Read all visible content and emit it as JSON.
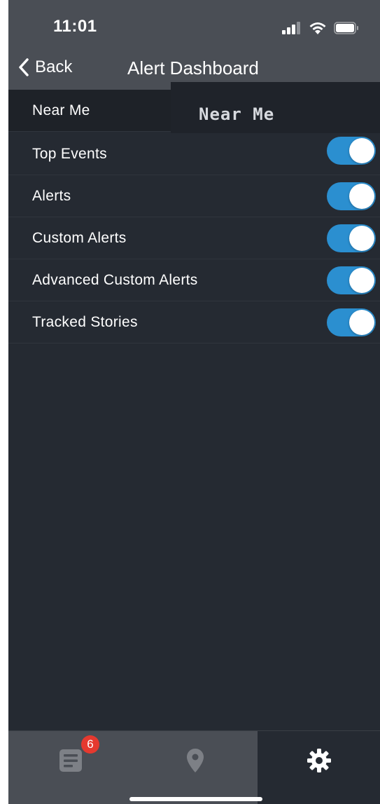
{
  "status_bar": {
    "time": "11:01",
    "icons": [
      "signal-icon",
      "wifi-icon",
      "battery-icon"
    ]
  },
  "nav": {
    "back_label": "Back",
    "title": "Alert Dashboard"
  },
  "near_me": {
    "label": "Near Me",
    "badge_text": "Near Me"
  },
  "settings": [
    {
      "label": "Top Events",
      "enabled": true
    },
    {
      "label": "Alerts",
      "enabled": true
    },
    {
      "label": "Custom Alerts",
      "enabled": true
    },
    {
      "label": "Advanced Custom Alerts",
      "enabled": true
    },
    {
      "label": "Tracked Stories",
      "enabled": true
    }
  ],
  "tabbar": {
    "news_badge": "6",
    "tabs": [
      "news-icon",
      "map-pin-icon",
      "gear-icon"
    ],
    "selected": "settings"
  },
  "colors": {
    "background": "#252a32",
    "bar": "#4a4e55",
    "toggle_on": "#2b8fd0",
    "badge": "#e5392f"
  }
}
